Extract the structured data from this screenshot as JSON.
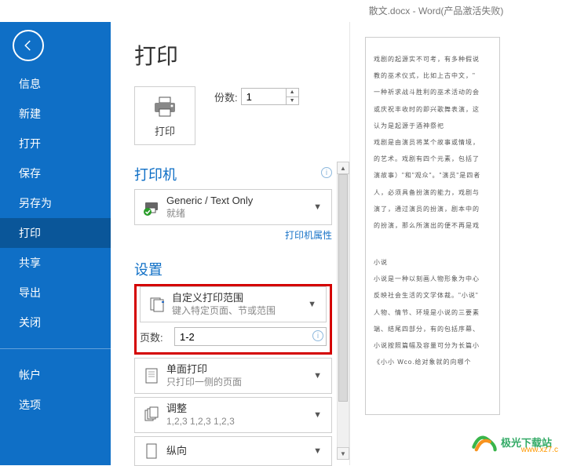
{
  "titlebar": "散文.docx - Word(产品激活失败)",
  "sidebar": {
    "items": [
      {
        "label": "信息"
      },
      {
        "label": "新建"
      },
      {
        "label": "打开"
      },
      {
        "label": "保存"
      },
      {
        "label": "另存为"
      },
      {
        "label": "打印"
      },
      {
        "label": "共享"
      },
      {
        "label": "导出"
      },
      {
        "label": "关闭"
      }
    ],
    "bottom": [
      {
        "label": "帐户"
      },
      {
        "label": "选项"
      }
    ],
    "active_index": 5
  },
  "main": {
    "title": "打印",
    "print_button": "打印",
    "copies_label": "份数:",
    "copies_value": "1",
    "printer_heading": "打印机",
    "printer": {
      "name": "Generic / Text Only",
      "status": "就绪"
    },
    "printer_props_link": "打印机属性",
    "settings_heading": "设置",
    "range_drop": {
      "t1": "自定义打印范围",
      "t2": "键入特定页面、节或范围"
    },
    "pages_label": "页数:",
    "pages_value": "1-2",
    "duplex_drop": {
      "t1": "单面打印",
      "t2": "只打印一侧的页面"
    },
    "collate_drop": {
      "t1": "调整",
      "t2": "1,2,3    1,2,3    1,2,3"
    },
    "orient_drop": {
      "t1": "纵向",
      "t2": ""
    }
  },
  "preview": {
    "p1": "戏剧的起源实不可考，有多种假说",
    "p2": "教的巫术仪式，比如上古中文，\"",
    "p3": "一种祈求战斗胜利的巫术活动的会",
    "p4": "或庆祝丰收时的即兴歌舞表演，这",
    "p5": "认为是起源于酒神祭祀",
    "p6": "戏剧是由演员将某个故事或情境，",
    "p7": "的艺术。戏剧有四个元素，包括了",
    "p8": "演故事）\"和\"观众\"。\"演员\"是四者",
    "p9": "人，必须具备扮演的能力，戏剧与",
    "p10": "演了，通过演员的扮演，剧本中的",
    "p11": "的扮演，那么所演出的便不再是戏",
    "g1": "小说",
    "g2": "小说是一种以刻画人物形象为中心",
    "g3": "反映社会生活的文学体裁。\"小说\"",
    "g4": "人物、情节、环境是小说的三要素",
    "g5": "端、结尾四部分，有的包括序幕、",
    "g6": "小说按照篇幅及容量可分为长篇小",
    "g7": "《小小 Wco.给对象就的向哪个"
  },
  "watermark": {
    "name": "极光下载站",
    "url": "www.xz7.c"
  }
}
